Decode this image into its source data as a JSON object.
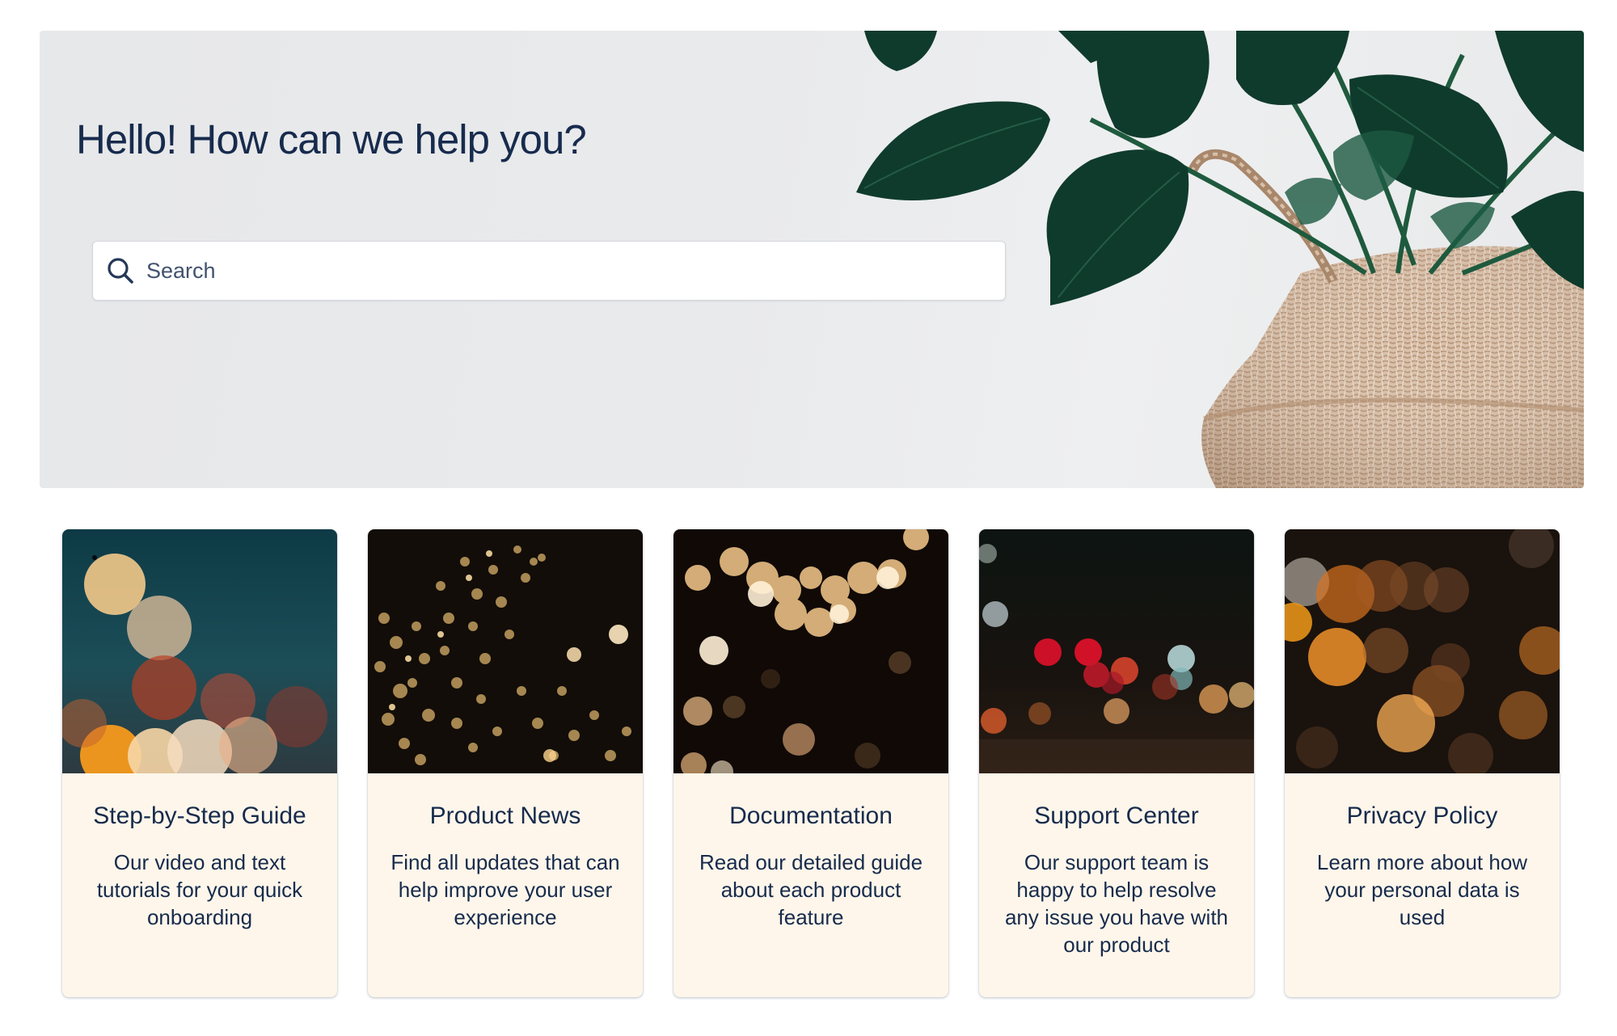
{
  "hero": {
    "title": "Hello! How can we help you?",
    "search_placeholder": "Search"
  },
  "cards": [
    {
      "title": "Step-by-Step Guide",
      "description": "Our video and text tutorials for your quick onboarding"
    },
    {
      "title": "Product News",
      "description": "Find all updates that can help improve your user experience"
    },
    {
      "title": "Documentation",
      "description": "Read our detailed guide about each product feature"
    },
    {
      "title": "Support Center",
      "description": "Our support team is happy to help resolve any issue you have with our product"
    },
    {
      "title": "Privacy Policy",
      "description": "Learn more about how your personal data is used"
    }
  ],
  "icons": {
    "search": "search-icon"
  },
  "colors": {
    "text": "#172b4d",
    "card_background": "#fef6ea",
    "hero_background": "#e9eaec"
  }
}
